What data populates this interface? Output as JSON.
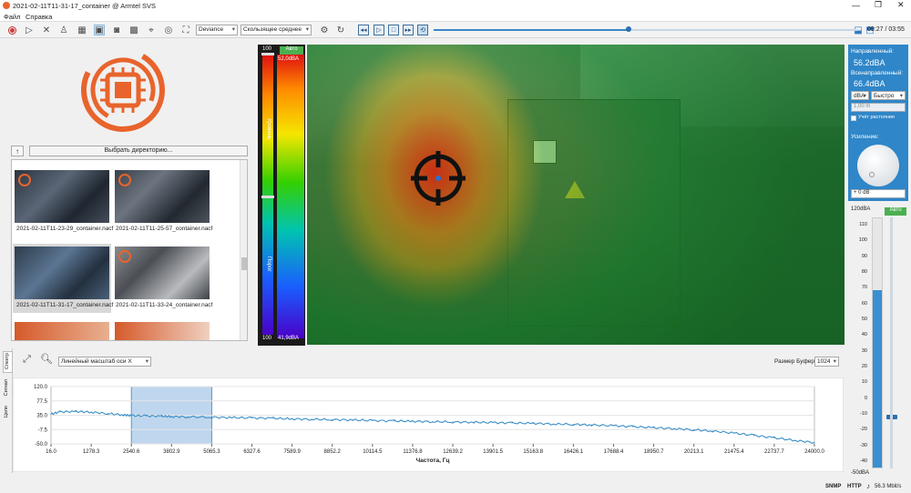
{
  "window": {
    "title": "2021-02-11T11-31-17_container @ Armtel SVS"
  },
  "menu": [
    "Файл",
    "Справка"
  ],
  "toolbar": {
    "mode_select": "Deviance",
    "avg_select": "Скользящее среднее",
    "time_readout": "09:27 / 03:55",
    "playback_progress": 0.46
  },
  "left": {
    "choose_dir_label": "Выбрать директорию...",
    "up_icon": "arrow-up-icon",
    "files": [
      {
        "name": "2021-02-11T11-23-29_container.nacf"
      },
      {
        "name": "2021-02-11T11-25-57_container.nacf"
      },
      {
        "name": "2021-02-11T11-31-17_container.nacf"
      },
      {
        "name": "2021-02-11T11-33-24_container.nacf"
      }
    ]
  },
  "colorbar": {
    "top_scale": "100",
    "bottom_scale": "100",
    "auto_label": "Авто",
    "max_label": "52,0dBA",
    "min_label": "41,9dBA",
    "level_label": "Уровень",
    "threshold_label": "Порог"
  },
  "right": {
    "directed_label": "Направленный:",
    "directed_value": "56.2dBA",
    "omni_label": "Всенаправленный:",
    "omni_value": "66.4dBA",
    "unit_select": "dBA",
    "speed_select": "Быстро",
    "distance_value": "1,00 m",
    "distance_check_label": "Учёт растояния",
    "gain_label": "Усиление:",
    "gain_value": "+ 0 dB",
    "meter_top": "120dBA",
    "meter_bottom": "-50dBA",
    "meter_auto": "Авто",
    "meter_ticks": [
      "110",
      "100",
      "90",
      "80",
      "70",
      "60",
      "50",
      "40",
      "30",
      "20",
      "10",
      "0",
      "-10",
      "-20",
      "-30",
      "-40"
    ],
    "meter_level": 0.71,
    "meter_slider": 0.39
  },
  "bottom": {
    "tabs": [
      "Спектр",
      "Сигнал",
      "Цели"
    ],
    "scale_select": "Линейный масштаб оси X",
    "buffer_label": "Размер Буфера:",
    "buffer_value": "1024",
    "xlabel": "Частота, Гц"
  },
  "status": {
    "snmp": "SNMP",
    "http": "HTTP",
    "rate": "56.3 Mbit/s"
  },
  "chart_data": {
    "type": "line",
    "xlabel": "Частота, Гц",
    "ylabel": "",
    "xlim": [
      16.0,
      24000.0
    ],
    "ylim": [
      -50.0,
      120.0
    ],
    "x_ticks": [
      "16.0",
      "1278.3",
      "2540.6",
      "3802.9",
      "5065.3",
      "6327.6",
      "7589.9",
      "8852.2",
      "10114.5",
      "11376.8",
      "12639.2",
      "13901.5",
      "15163.8",
      "16426.1",
      "17688.4",
      "18950.7",
      "20213.1",
      "21475.4",
      "22737.7",
      "24000.0"
    ],
    "y_ticks": [
      "120.0",
      "77.5",
      "35.0",
      "-7.5",
      "-50.0"
    ],
    "selection": [
      2540.6,
      5065.3
    ],
    "series": [
      {
        "x": [
          16,
          300,
          800,
          1278,
          1800,
          2300,
          2540,
          3000,
          3500,
          3802,
          4300,
          5065,
          5700,
          6327,
          7000,
          7589,
          8200,
          8852,
          9500,
          10114,
          10800,
          11376,
          12000,
          12639,
          13300,
          13901,
          14500,
          15163,
          15800,
          16426,
          17000,
          17688,
          18300,
          18950,
          19600,
          20213,
          20800,
          21475,
          22100,
          22737,
          23400,
          24000
        ],
        "y": [
          38,
          45,
          46,
          44,
          40,
          36,
          34,
          33,
          32,
          31,
          30,
          29,
          28,
          27,
          26,
          24,
          23,
          22,
          21,
          19,
          18,
          17,
          16,
          15,
          14,
          13,
          12,
          11,
          9,
          8,
          6,
          4,
          1,
          -2,
          -5,
          -8,
          -12,
          -18,
          -25,
          -32,
          -40,
          -46
        ]
      }
    ]
  }
}
